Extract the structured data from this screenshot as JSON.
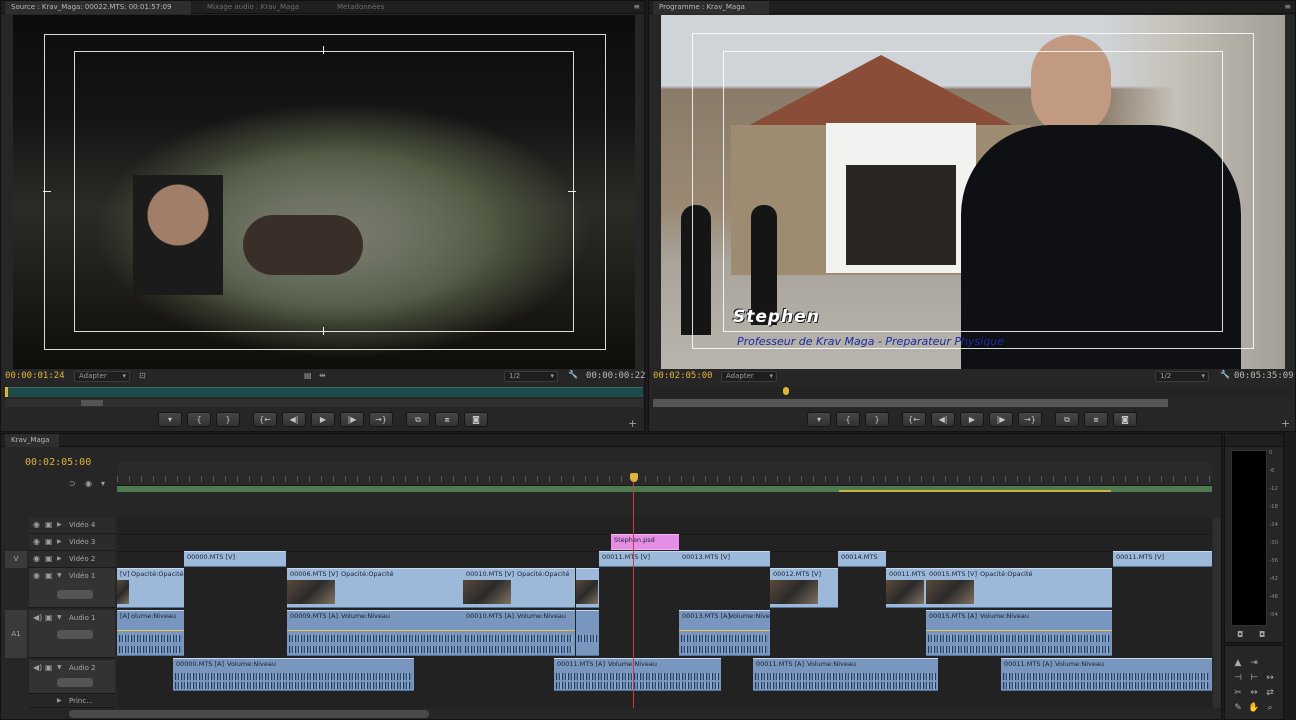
{
  "source_monitor": {
    "tab1": "Source : Krav_Maga: 00022.MTS: 00:01:57:09",
    "tab2": "Mixage audio : Krav_Maga",
    "tab3": "Métadonnées",
    "timecode_in": "00:00:01:24",
    "timecode_out": "00:00:00:22",
    "fit": "Adapter",
    "res": "1/2"
  },
  "program_monitor": {
    "tab1": "Programme : Krav_Maga",
    "timecode_in": "00:02:05:00",
    "timecode_out": "00:05:35:09",
    "fit": "Adapter",
    "res": "1/2",
    "title_name": "Stephen",
    "title_sub": "Professeur de Krav Maga - Preparateur Physique"
  },
  "transport_icons": [
    "marker-icon",
    "mark-in-icon",
    "mark-out-icon",
    "go-to-in-icon",
    "step-back-icon",
    "play-icon",
    "step-forward-icon",
    "go-to-out-icon",
    "insert-icon",
    "overwrite-icon",
    "camera-icon"
  ],
  "transport_glyphs": [
    "▾",
    "{",
    "}",
    "{←",
    "◀|",
    "▶",
    "|▶",
    "→}",
    "⧉",
    "⧈",
    "◙"
  ],
  "timeline": {
    "tab": "Krav_Maga",
    "timecode": "00:02:05:00",
    "tracks": {
      "v4": "Vidéo 4",
      "v3": "Vidéo 3",
      "v2": "Vidéo 2",
      "v1": "Vidéo 1",
      "a1": "Audio 1",
      "a2": "Audio 2",
      "master": "Princ..."
    },
    "source_v": "V",
    "source_a": "A1",
    "clips": {
      "v2": [
        "00000.MTS [V]",
        "00011.MTS [V]",
        "00013.MTS [V]",
        "00014.MTS",
        "00011.MTS [V]"
      ],
      "v3": [
        "Stephen.psd"
      ],
      "v1": [
        "[V]",
        "Opacité:Opacité",
        "00006.MTS [V]",
        "Opacité:Opacité",
        "00010.MTS [V]",
        "Opacité:Opacité",
        "00012.MTS [V]",
        "00011.MTS [V]",
        "00015.MTS [V]",
        "Opacité:Opacité"
      ],
      "a1": [
        "[A]",
        "olume:Niveau",
        "00009.MTS [A]",
        "Volume:Niveau",
        "00010.MTS [A]",
        "Volume:Niveau",
        "00013.MTS [A]",
        "Volume:Niveau",
        "00015.MTS [A]",
        "Volume:Niveau"
      ],
      "a2": [
        "00000.MTS [A]",
        "Volume:Niveau",
        "00011.MTS [A]",
        "Volume:Niveau",
        "00011.MTS [A]",
        "Volume:Niveau",
        "00011.MTS [A]",
        "Volume:Niveau"
      ]
    }
  },
  "meter": {
    "labels": [
      "0",
      "-6",
      "-12",
      "-18",
      "-24",
      "-30",
      "-36",
      "-42",
      "-48",
      "-54"
    ]
  },
  "tools": [
    "select-tool",
    "track-select-tool",
    "ripple-tool",
    "rolling-tool",
    "rate-stretch-tool",
    "razor-tool",
    "slip-tool",
    "slide-tool",
    "pen-tool",
    "hand-tool",
    "zoom-tool"
  ],
  "tool_glyphs": [
    "▲",
    "⇥",
    "⊣",
    "⊢",
    "↔",
    "✂",
    "⇔",
    "⇄",
    "✎",
    "✋",
    "⌕"
  ],
  "colors": {
    "timecode": "#e0b33a",
    "video_clip": "#9db9da",
    "title_clip": "#e68ee6",
    "playhead": "#d33b3b"
  }
}
